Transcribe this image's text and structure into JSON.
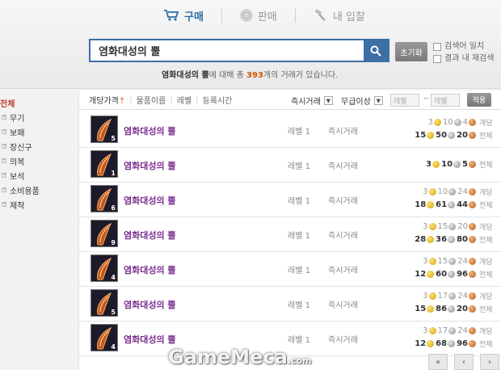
{
  "tabs": [
    {
      "label": "구매",
      "icon": "cart-icon",
      "active": true
    },
    {
      "label": "판매",
      "icon": "coin-icon",
      "active": false
    },
    {
      "label": "내 입찰",
      "icon": "hammer-icon",
      "active": false
    }
  ],
  "search": {
    "value": "염화대성의 뿔",
    "reset_label": "초기화",
    "option_research": "검색어 일치",
    "option_within": "결과 내 재검색"
  },
  "result": {
    "query": "염화대성의 뿔",
    "mid": "에 대해 총 ",
    "count": "393",
    "tail": "개의 거래가 있습니다."
  },
  "sidebar": {
    "all_label": "전체",
    "items": [
      "무기",
      "보패",
      "장신구",
      "의복",
      "보석",
      "소비용품",
      "제작"
    ]
  },
  "sortbar": {
    "sort_price": "개당가격",
    "sort_price_arrow": "↑",
    "sort_name": "물품이름",
    "sort_level": "레벨",
    "sort_time": "등록시간",
    "filter_trade": "즉시거래",
    "filter_min": "무급이상",
    "level_min_placeholder": "레벨",
    "level_sep": "~",
    "level_max_placeholder": "레벨",
    "apply_label": "적용"
  },
  "rows": [
    {
      "qty": "5",
      "name": "염화대성의 뿔",
      "level": "레벨 1",
      "type": "즉시거래",
      "unit": [
        "3",
        "10",
        "4"
      ],
      "unit_label": "개당",
      "total": [
        "15",
        "50",
        "20"
      ],
      "total_label": "전체"
    },
    {
      "qty": "1",
      "name": "염화대성의 뿔",
      "level": "레벨 1",
      "type": "즉시거래",
      "unit": null,
      "unit_label": "",
      "total": [
        "3",
        "10",
        "5"
      ],
      "total_label": "전체"
    },
    {
      "qty": "6",
      "name": "염화대성의 뿔",
      "level": "레벨 1",
      "type": "즉시거래",
      "unit": [
        "3",
        "10",
        "24"
      ],
      "unit_label": "개당",
      "total": [
        "18",
        "61",
        "44"
      ],
      "total_label": "전체"
    },
    {
      "qty": "9",
      "name": "염화대성의 뿔",
      "level": "레벨 1",
      "type": "즉시거래",
      "unit": [
        "3",
        "15",
        "20"
      ],
      "unit_label": "개당",
      "total": [
        "28",
        "36",
        "80"
      ],
      "total_label": "전체"
    },
    {
      "qty": "4",
      "name": "염화대성의 뿔",
      "level": "레벨 1",
      "type": "즉시거래",
      "unit": [
        "3",
        "15",
        "24"
      ],
      "unit_label": "개당",
      "total": [
        "12",
        "60",
        "96"
      ],
      "total_label": "전체"
    },
    {
      "qty": "5",
      "name": "염화대성의 뿔",
      "level": "레벨 1",
      "type": "즉시거래",
      "unit": [
        "3",
        "17",
        "24"
      ],
      "unit_label": "개당",
      "total": [
        "15",
        "86",
        "20"
      ],
      "total_label": "전체"
    },
    {
      "qty": "4",
      "name": "염화대성의 뿔",
      "level": "레벨 1",
      "type": "즉시거래",
      "unit": [
        "3",
        "17",
        "24"
      ],
      "unit_label": "개당",
      "total": [
        "12",
        "68",
        "96"
      ],
      "total_label": "전체"
    }
  ],
  "watermark": {
    "text": "GameMeca",
    "suffix": ".com"
  },
  "pager": {
    "first": "«",
    "prev": "‹",
    "next": "›"
  }
}
